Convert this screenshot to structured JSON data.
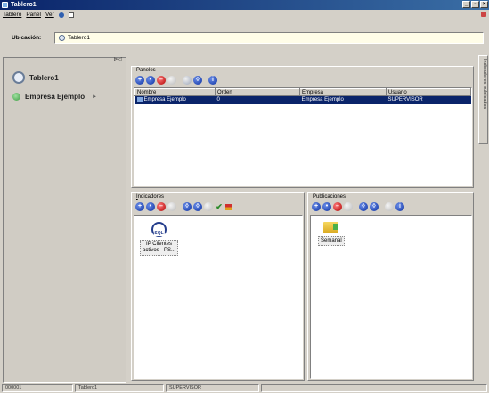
{
  "window": {
    "title": "Tablero1"
  },
  "menu": {
    "items": [
      "Tablero",
      "Panel",
      "Ver"
    ]
  },
  "location": {
    "label": "Ubicación:",
    "value": "Tablero1"
  },
  "left_panel": {
    "items": [
      {
        "label": "Tablero1",
        "icon": "dashboard-icon"
      },
      {
        "label": "Empresa Ejemplo",
        "icon": "company-icon"
      }
    ]
  },
  "paneles": {
    "title": "Paneles",
    "columns": [
      "Nombre",
      "Orden",
      "Empresa",
      "Usuario"
    ],
    "rows": [
      [
        "Empresa Ejemplo",
        "0",
        "Empresa Ejemplo",
        "SUPERVISOR"
      ]
    ]
  },
  "indicadores": {
    "title_first": "I",
    "title_rest": "ndicadores",
    "items": [
      {
        "label_line1": "IP Clientes",
        "label_line2": "activos - PS..."
      }
    ]
  },
  "publicaciones": {
    "title": "Publicaciones",
    "items": [
      {
        "label": "Semanal"
      }
    ]
  },
  "side_tab": {
    "label": "Indicadores publicados"
  },
  "status": {
    "cells": [
      "000001",
      "Tablero1",
      "SUPERVISOR"
    ]
  },
  "colors": {
    "title_bar": "#0a246a",
    "selection": "#0a246a"
  }
}
